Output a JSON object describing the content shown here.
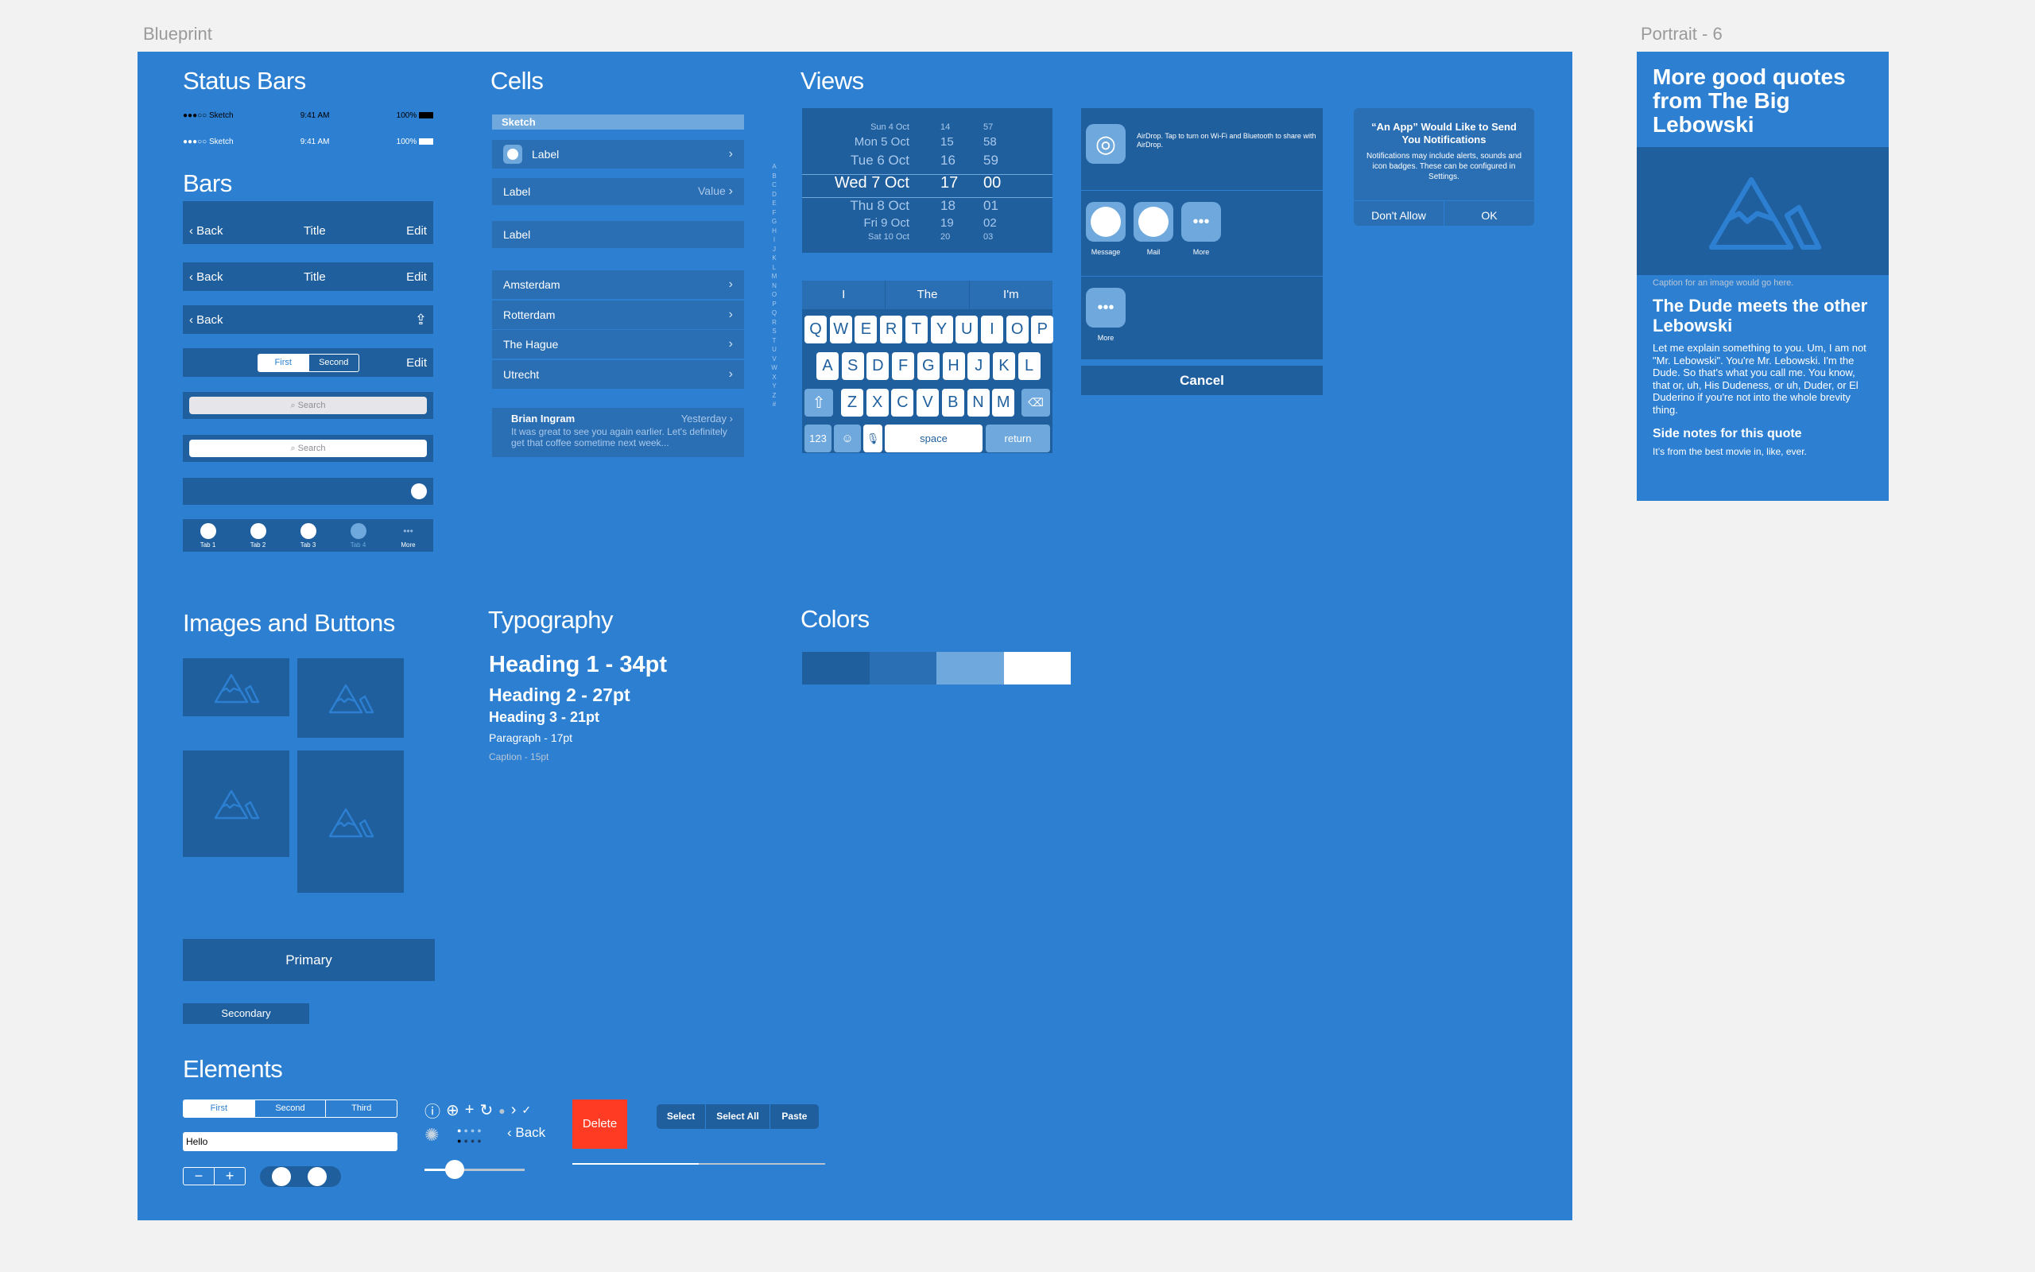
{
  "artboards": {
    "blueprint": "Blueprint",
    "portrait": "Portrait - 6"
  },
  "status_bars": {
    "title": "Status Bars",
    "carrier": "●●●○○ Sketch",
    "time": "9:41 AM",
    "battery": "100%"
  },
  "bars": {
    "title": "Bars",
    "back": "Back",
    "nav_title": "Title",
    "edit": "Edit",
    "seg_first": "First",
    "seg_second": "Second",
    "search_placeholder": "Search",
    "tabs": [
      "Tab 1",
      "Tab 2",
      "Tab 3",
      "Tab 4",
      "More"
    ]
  },
  "cells": {
    "title": "Cells",
    "header": "Sketch",
    "label": "Label",
    "value": "Value",
    "cities": [
      "Amsterdam",
      "Rotterdam",
      "The Hague",
      "Utrecht"
    ],
    "message": {
      "sender": "Brian Ingram",
      "time": "Yesterday",
      "preview": "It was great to see you again earlier. Let's definitely get that coffee sometime next week..."
    },
    "index": [
      "A",
      "B",
      "C",
      "D",
      "E",
      "F",
      "G",
      "H",
      "I",
      "J",
      "K",
      "L",
      "M",
      "N",
      "O",
      "P",
      "Q",
      "R",
      "S",
      "T",
      "U",
      "V",
      "W",
      "X",
      "Y",
      "Z",
      "#"
    ]
  },
  "views": {
    "title": "Views",
    "picker": [
      [
        "Sun 4 Oct",
        "14",
        "57"
      ],
      [
        "Mon 5 Oct",
        "15",
        "58"
      ],
      [
        "Tue 6 Oct",
        "16",
        "59"
      ],
      [
        "Wed 7 Oct",
        "17",
        "00"
      ],
      [
        "Thu 8 Oct",
        "18",
        "01"
      ],
      [
        "Fri 9 Oct",
        "19",
        "02"
      ],
      [
        "Sat 10 Oct",
        "20",
        "03"
      ]
    ],
    "keyboard": {
      "suggestions": [
        "I",
        "The",
        "I'm"
      ],
      "row1": [
        "Q",
        "W",
        "E",
        "R",
        "T",
        "Y",
        "U",
        "I",
        "O",
        "P"
      ],
      "row2": [
        "A",
        "S",
        "D",
        "F",
        "G",
        "H",
        "J",
        "K",
        "L"
      ],
      "row3": [
        "Z",
        "X",
        "C",
        "V",
        "B",
        "N",
        "M"
      ],
      "numbers": "123",
      "space": "space",
      "return": "return"
    },
    "share": {
      "airdrop": "AirDrop. Tap to turn on Wi-Fi and Bluetooth to share with AirDrop.",
      "apps": [
        "Message",
        "Mail",
        "More"
      ],
      "more": "More",
      "cancel": "Cancel"
    },
    "alert": {
      "title": "“An App” Would Like to Send You Notifications",
      "body": "Notifications may include alerts, sounds and icon badges. These can be configured in Settings.",
      "deny": "Don't Allow",
      "ok": "OK"
    }
  },
  "images_buttons": {
    "title": "Images and Buttons",
    "primary": "Primary",
    "secondary": "Secondary"
  },
  "typography": {
    "title": "Typography",
    "h1": "Heading 1 - 34pt",
    "h2": "Heading 2 - 27pt",
    "h3": "Heading 3 - 21pt",
    "p": "Paragraph - 17pt",
    "caption": "Caption - 15pt"
  },
  "colors": {
    "title": "Colors",
    "swatches": [
      "#1f5f9e",
      "#2a6eb3",
      "#6ea8dd",
      "#ffffff"
    ],
    "background": "#2c7fd1",
    "delete": "#ff3b24"
  },
  "elements": {
    "title": "Elements",
    "segments": [
      "First",
      "Second",
      "Third"
    ],
    "text_value": "Hello",
    "delete": "Delete",
    "menu": [
      "Select",
      "Select All",
      "Paste"
    ],
    "back": "Back",
    "slider_value": 0.3,
    "progress_value": 0.5
  },
  "portrait": {
    "title": "More good quotes from The Big Lebowski",
    "caption": "Caption for an image would go here.",
    "heading": "The Dude meets the other Lebowski",
    "body": "Let me explain something to you. Um, I am not \"Mr. Lebowski\". You're Mr. Lebowski. I'm the Dude. So that's what you call me. You know, that or, uh, His Dudeness, or uh, Duder, or El Duderino if you're not into the whole brevity thing.",
    "side_heading": "Side notes for this quote",
    "side_text": "It’s from the best movie in, like, ever."
  }
}
